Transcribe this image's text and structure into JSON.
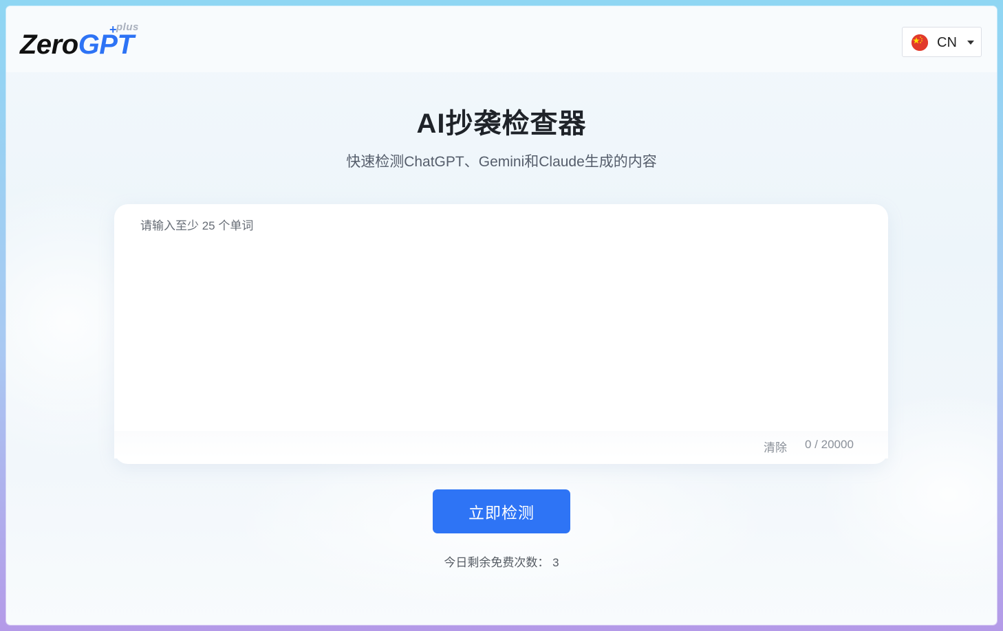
{
  "header": {
    "logo": {
      "zero": "Zero",
      "gpt": "GPT",
      "plus": "plus"
    },
    "language": {
      "selected": "CN",
      "flag_icon": "china-flag-icon",
      "dropdown_icon": "chevron-down-icon"
    }
  },
  "main": {
    "title": "AI抄袭检查器",
    "subtitle": "快速检测ChatGPT、Gemini和Claude生成的内容",
    "editor": {
      "value": "",
      "placeholder": "请输入至少 25 个单词",
      "clear_label": "清除",
      "char_count": "0 / 20000"
    },
    "detect_button_label": "立即检测",
    "remaining": "今日剩余免费次数： 3"
  },
  "colors": {
    "accent": "#2e74f5",
    "title": "#1f2329",
    "flag_red": "#e23a2b",
    "flag_yellow": "#ffde00"
  }
}
